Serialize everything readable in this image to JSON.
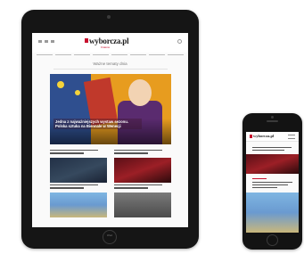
{
  "tablet": {
    "logo_text": "wyborcza.pl",
    "logo_subtitle": "Kraków",
    "section_title": "Ważne tematy dnia",
    "hero_caption": "Jedna z najważniejszych wystaw sezonu. Polska sztuka na Biennale w Wenecji",
    "brand": "iPad"
  },
  "phone": {
    "logo_text": "wyborcza.pl"
  },
  "colors": {
    "brand_red": "#c8102e",
    "device_black": "#151515"
  }
}
